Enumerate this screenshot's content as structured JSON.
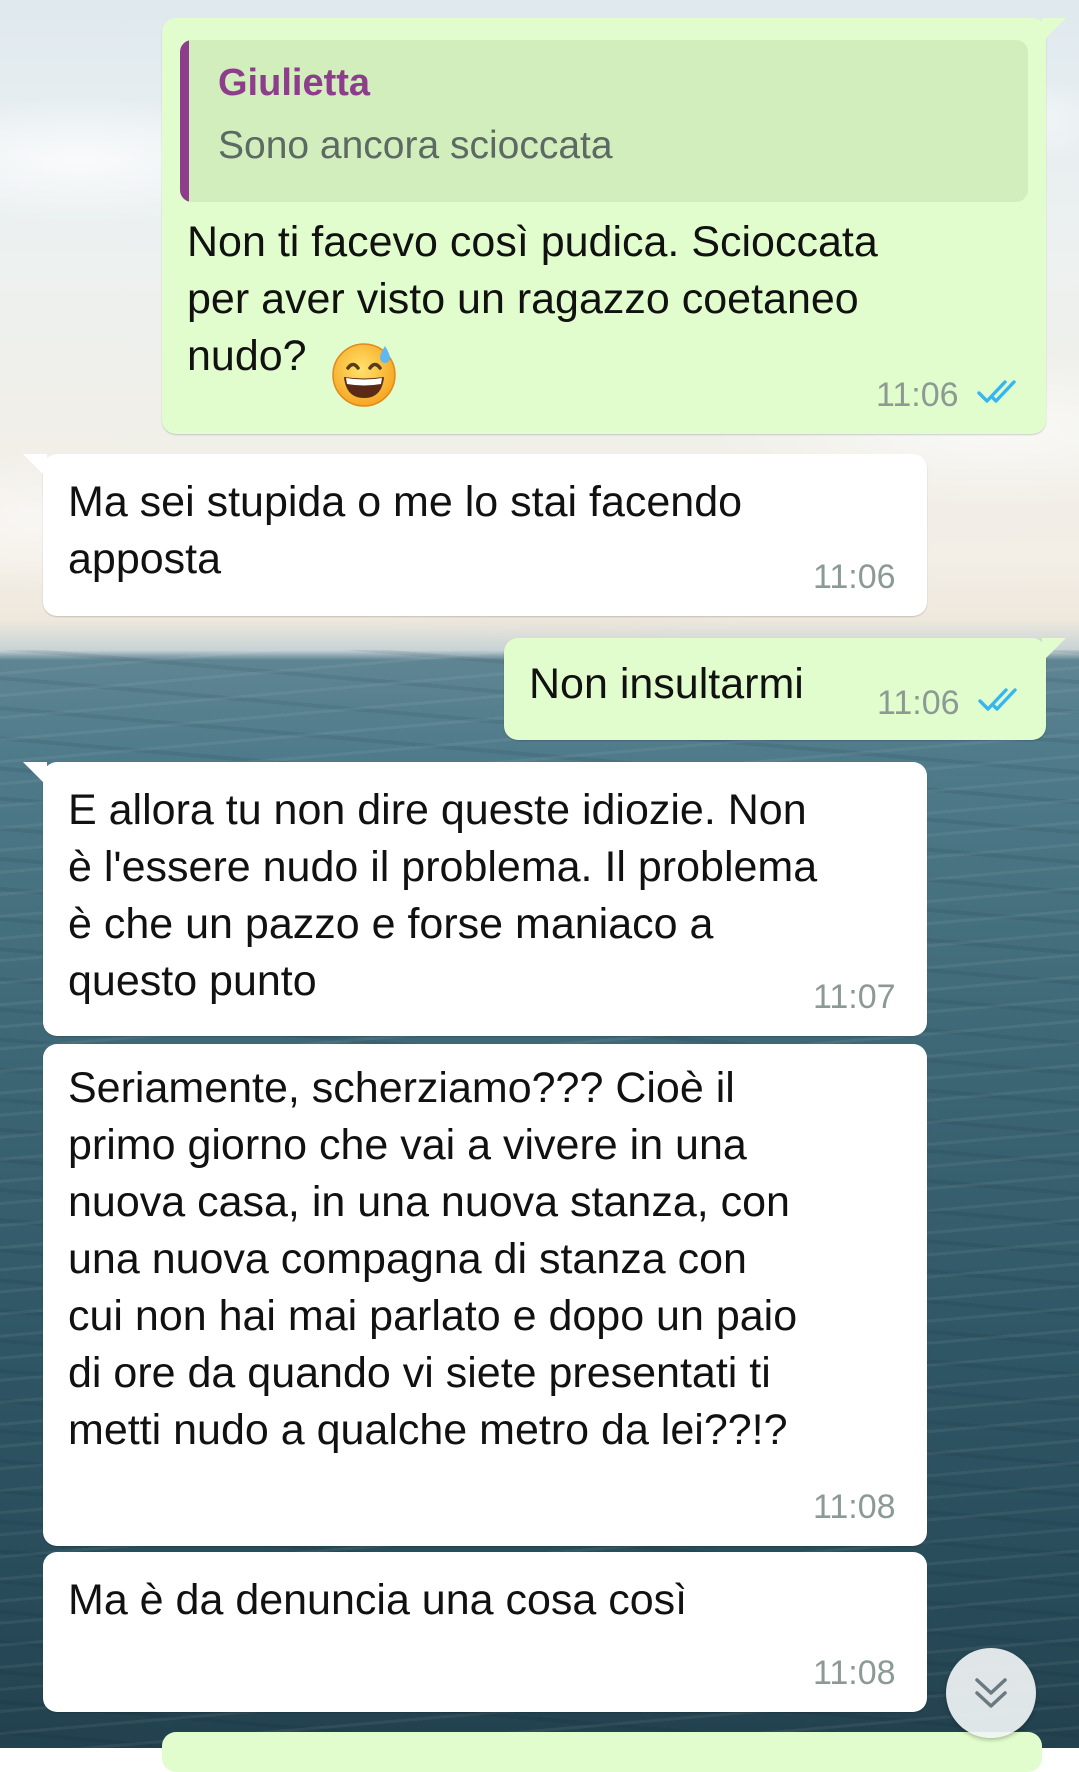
{
  "conversation": {
    "messages": [
      {
        "direction": "outgoing",
        "reply_to": {
          "sender": "Giulietta",
          "text": "Sono ancora scioccata"
        },
        "text": "Non ti facevo così pudica. Scioccata\nper aver visto un ragazzo coetaneo\nnudo?",
        "emoji": "grinning-face-with-sweat",
        "time": "11:06",
        "status": "read"
      },
      {
        "direction": "incoming",
        "text": "Ma sei stupida o me lo stai facendo\napposta",
        "time": "11:06"
      },
      {
        "direction": "outgoing",
        "text": "Non insultarmi",
        "time": "11:06",
        "status": "read"
      },
      {
        "direction": "incoming",
        "text": "E allora tu non dire queste idiozie. Non\nè l'essere nudo il problema. Il problema\nè che un pazzo e forse maniaco a\nquesto punto",
        "time": "11:07"
      },
      {
        "direction": "incoming",
        "text": "Seriamente, scherziamo??? Cioè il\nprimo giorno che vai a vivere in una\nnuova casa, in una nuova stanza, con\nuna nuova compagna di stanza con\ncui non hai mai parlato e dopo un paio\ndi ore da quando vi siete presentati ti\nmetti nudo a qualche metro da lei??!?",
        "time": "11:08"
      },
      {
        "direction": "incoming",
        "text": "Ma è da denuncia una cosa così",
        "time": "11:08"
      }
    ]
  },
  "colors": {
    "outgoing_bubble": "#e2fdcd",
    "incoming_bubble": "#ffffff",
    "quote_sender": "#8e3d8c",
    "read_ticks": "#34b7f1",
    "timestamp": "#8c9a94"
  },
  "icons": {
    "read_receipt": "double-check-icon",
    "scroll_down": "double-chevron-down-icon"
  }
}
